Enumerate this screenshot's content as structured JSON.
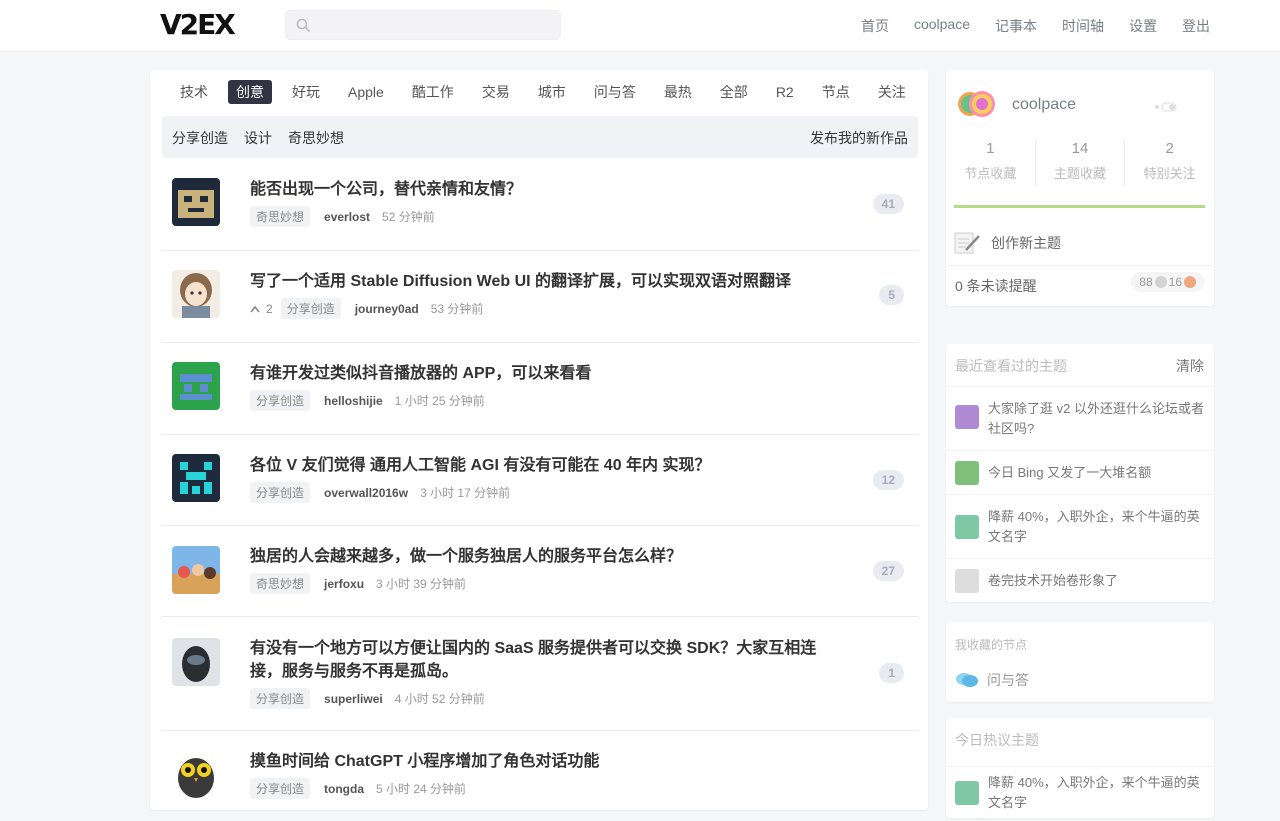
{
  "header": {
    "logo": "V2EX",
    "search_placeholder": "",
    "nav": [
      "首页",
      "coolpace",
      "记事本",
      "时间轴",
      "设置",
      "登出"
    ]
  },
  "tabs": {
    "items": [
      "技术",
      "创意",
      "好玩",
      "Apple",
      "酷工作",
      "交易",
      "城市",
      "问与答",
      "最热",
      "全部",
      "R2",
      "节点",
      "关注"
    ],
    "active": "创意"
  },
  "subbar": {
    "links": [
      "分享创造",
      "设计",
      "奇思妙想"
    ],
    "action": "发布我的新作品"
  },
  "topics": [
    {
      "title": "能否出现一个公司，替代亲情和友情？",
      "node": "奇思妙想",
      "author": "everlost",
      "time": "52 分钟前",
      "replies": "41",
      "votes": ""
    },
    {
      "title": "写了一个适用 Stable Diffusion Web UI 的翻译扩展，可以实现双语对照翻译",
      "node": "分享创造",
      "author": "journey0ad",
      "time": "53 分钟前",
      "replies": "5",
      "votes": "2"
    },
    {
      "title": "有谁开发过类似抖音播放器的 APP，可以来看看",
      "node": "分享创造",
      "author": "helloshijie",
      "time": "1 小时 25 分钟前",
      "replies": "",
      "votes": ""
    },
    {
      "title": "各位 V 友们觉得 通用人工智能 AGI 有没有可能在 40 年内 实现？",
      "node": "分享创造",
      "author": "overwall2016w",
      "time": "3 小时 17 分钟前",
      "replies": "12",
      "votes": ""
    },
    {
      "title": "独居的人会越来越多，做一个服务独居人的服务平台怎么样？",
      "node": "奇思妙想",
      "author": "jerfoxu",
      "time": "3 小时 39 分钟前",
      "replies": "27",
      "votes": ""
    },
    {
      "title": "有没有一个地方可以方便让国内的 SaaS 服务提供者可以交换 SDK？大家互相连接，服务与服务不再是孤岛。",
      "node": "分享创造",
      "author": "superliwei",
      "time": "4 小时 52 分钟前",
      "replies": "1",
      "votes": ""
    },
    {
      "title": "摸鱼时间给 ChatGPT 小程序增加了角色对话功能",
      "node": "分享创造",
      "author": "tongda",
      "time": "5 小时 24 分钟前",
      "replies": "",
      "votes": ""
    }
  ],
  "user": {
    "name": "coolpace",
    "stats": [
      {
        "num": "1",
        "label": "节点收藏"
      },
      {
        "num": "14",
        "label": "主题收藏"
      },
      {
        "num": "2",
        "label": "特别关注"
      }
    ],
    "create": "创作新主题",
    "unread": "0 条未读提醒",
    "silver": "88",
    "bronze": "16"
  },
  "recent": {
    "title": "最近查看过的主题",
    "clear": "清除",
    "items": [
      "大家除了逛 v2 以外还逛什么论坛或者社区吗?",
      "今日 Bing 又发了一大堆名额",
      "降薪 40%，入职外企，来个牛逼的英文名字",
      "卷完技术开始卷形象了"
    ]
  },
  "fav_nodes": {
    "title": "我收藏的节点",
    "items": [
      "问与答"
    ]
  },
  "hot": {
    "title": "今日热议主题",
    "items": [
      "降薪 40%，入职外企，来个牛逼的英文名字"
    ]
  },
  "colors": {
    "accent": "#334455",
    "progress": "#b7d98a"
  }
}
